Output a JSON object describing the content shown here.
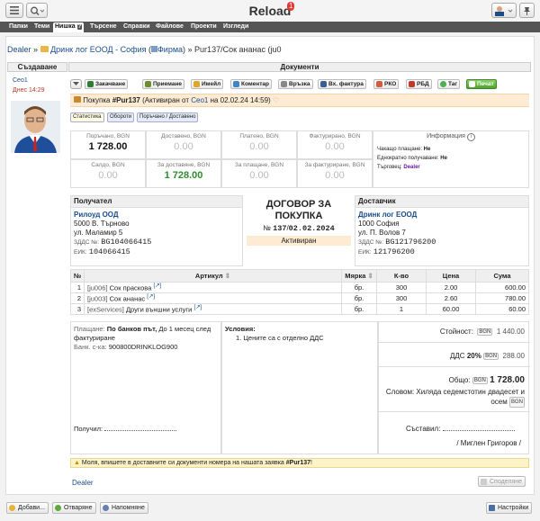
{
  "app": {
    "title": "Reload",
    "badge": "1"
  },
  "nav": [
    "Папки",
    "Теми",
    "Нишка",
    "Търсене",
    "Справки",
    "Файлове",
    "Проекти",
    "Изгледи"
  ],
  "breadcrumb": {
    "root": "Dealer",
    "sep": "»",
    "company": "Дринк лог ЕООД - София",
    "firm": "Фирма",
    "current": "» Pur137/Сок ананас (ju0"
  },
  "left": {
    "header": "Създаване",
    "user": "Ceo1",
    "time": "Днес 14:29"
  },
  "doc_header": "Документи",
  "toolbar": [
    "Закачване",
    "Приемане",
    "Имейл",
    "Коментар",
    "Връзка",
    "Вх. фактура",
    "РКО",
    "РБД",
    "Таг",
    "Печат"
  ],
  "banner": {
    "text_a": "Покупка ",
    "id": "#Pur137",
    "text_b": " (Активиран от ",
    "user": "Ceo1",
    "text_c": " на 02.02.24 14:59)"
  },
  "subtabs": [
    "Статистика",
    "Обороти",
    "Поръчано / Доставено"
  ],
  "metrics_row1": [
    {
      "label": "Поръчано, BGN",
      "value": "1 728.00"
    },
    {
      "label": "Доставено, BGN",
      "value": "0.00"
    },
    {
      "label": "Платено, BGN",
      "value": "0.00"
    },
    {
      "label": "Фактурирано, BGN",
      "value": "0.00"
    }
  ],
  "metrics_row2": [
    {
      "label": "Салдо, BGN",
      "value": "0.00"
    },
    {
      "label": "За доставяне, BGN",
      "value": "1 728.00"
    },
    {
      "label": "За плащане, BGN",
      "value": "0.00"
    },
    {
      "label": "За фактуриране, BGN",
      "value": "0.00"
    }
  ],
  "info": {
    "title": "Информация",
    "l1": "Чакащо плащане:",
    "v1": "Не",
    "l2": "Еднократно получаване:",
    "v2": "Не",
    "l3": "Търговец:",
    "v3": "Dealer"
  },
  "recipient": {
    "header": "Получател",
    "name": "Рилоуд ООД",
    "city": "5000 В. Търново",
    "street": "ул. Маламир 5",
    "vat_lbl": "ЗДДС №:",
    "vat": "BG104066415",
    "eik_lbl": "ЕИК:",
    "eik": "104066415"
  },
  "contract": {
    "title": "ДОГОВОР ЗА ПОКУПКА",
    "no_lbl": "№",
    "no": "137",
    "sep": "/",
    "date": "02.02.2024",
    "status": "Активиран"
  },
  "supplier": {
    "header": "Доставчик",
    "name": "Дринк лог ЕООД",
    "city": "1000 София",
    "street": "ул. П. Волов 7",
    "vat_lbl": "ЗДДС №:",
    "vat": "BG121796200",
    "eik_lbl": "ЕИК:",
    "eik": "121796200"
  },
  "table": {
    "headers": [
      "№",
      "Артикул",
      "Мярка",
      "К-во",
      "Цена",
      "Сума"
    ],
    "rows": [
      {
        "n": "1",
        "code": "ju006",
        "name": "Сок праскова",
        "unit": "бр.",
        "qty": "300",
        "price": "2.00",
        "sum": "600.00"
      },
      {
        "n": "2",
        "code": "ju003",
        "name": "Сок ананас",
        "unit": "бр.",
        "qty": "300",
        "price": "2.60",
        "sum": "780.00"
      },
      {
        "n": "3",
        "code": "exServices",
        "name": "Други външни услуги",
        "unit": "бр.",
        "qty": "1",
        "price": "60.00",
        "sum": "60.00"
      }
    ]
  },
  "payment": {
    "lbl": "Плащане:",
    "method": "По банков път,",
    "term": " До 1 месец след фактуриране",
    "bank_lbl": "Банк. с-ка:",
    "bank": "900800DRINKLOG900"
  },
  "conditions": {
    "title": "Условия:",
    "items": [
      "Цените са с отделно ДДС"
    ]
  },
  "totals": {
    "value_lbl": "Стойност:",
    "ccy": "BGN",
    "value": "1 440.00",
    "vat_lbl": "ДДС",
    "vat_pct": "20%",
    "vat": "288.00",
    "total_lbl": "Общо:",
    "total": "1 728.00",
    "words_lbl": "Словом:",
    "words": "Хиляда седемстотин двадесет и осем"
  },
  "received": {
    "lbl": "Получил:"
  },
  "created": {
    "lbl": "Съставил:",
    "name": "/ Миглен Григоров /"
  },
  "warning": {
    "text_a": "Моля, впишете в доставните си документи номера на нашата заявка ",
    "id": "#Pur137",
    "text_b": "!"
  },
  "footer": {
    "link": "Dealer",
    "share": "Споделяне"
  },
  "bottom": {
    "add": "Добави...",
    "reject": "Отваряне",
    "remind": "Напомняне",
    "settings": "Настройки"
  },
  "colors": {
    "link": "#1a4c8c",
    "banner": "#fdebd3",
    "green": "#2e8b2e"
  }
}
